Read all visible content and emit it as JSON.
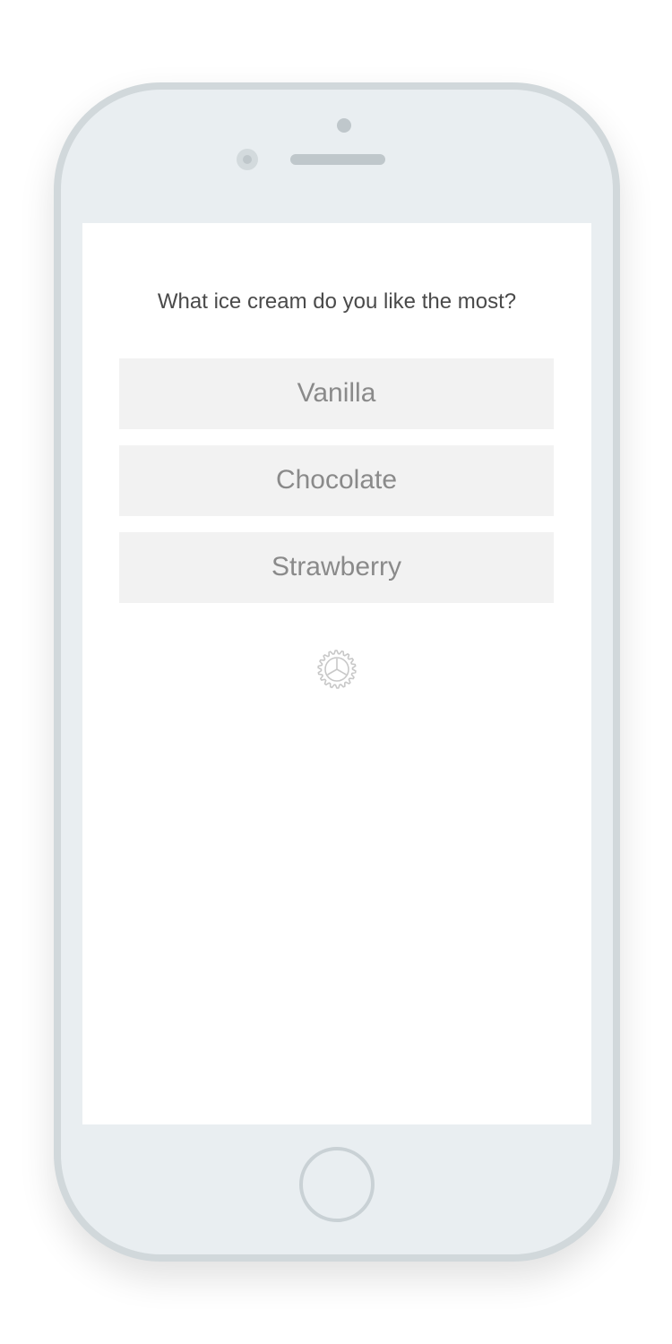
{
  "question": "What ice cream do you like the most?",
  "choices": [
    {
      "label": "Vanilla"
    },
    {
      "label": "Chocolate"
    },
    {
      "label": "Strawberry"
    }
  ],
  "icons": {
    "settings": "gear-icon",
    "home": "home-button-icon"
  },
  "colors": {
    "device_body": "#e9eef1",
    "device_border": "#d1d8db",
    "screen_bg": "#ffffff",
    "choice_bg": "#f2f2f2",
    "choice_text": "#8a8a8a",
    "question_text": "#4a4a4a",
    "gear": "#c8c8c8"
  }
}
